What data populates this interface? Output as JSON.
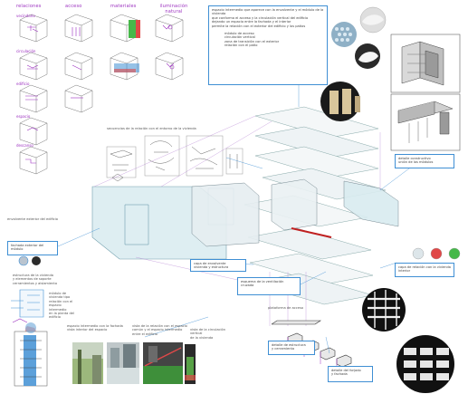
{
  "columns": [
    "relaciones",
    "acceso",
    "materiales",
    "iluminación natural"
  ],
  "rows": [
    "vecindario",
    "circulación",
    "edificio",
    "espacio",
    "descanso"
  ],
  "notes": {
    "top_text": "espacio intermedio que aparece con la envolvente y el módulo de la vivienda\nque conforma el acceso y la circulación vertical del edificio\ndejando un espacio entre la fachada y el interior\npermite la relación con el exterior del edificio y los patios",
    "top_sub": "módulo de acceso\ncirculación vertical\nzona de transición con el exterior\nrelación con el patio",
    "sketches": "secuencias de la relación con el entorno de la vivienda",
    "facade_label": "envolvente exterior del edificio",
    "left_mid": "fachada exterior del módulo",
    "env_label": "capa de envolvente\nvivienda y estructura",
    "circ_label": "esquema de la ventilación cruzada",
    "struct_label": "estructura de la vivienda\ny elementos de soporte\ncerramientos y aislamiento",
    "access_label": "plataforma de acceso",
    "right_top_label": "detalle constructivo\nunión de los módulos",
    "right_mid_label": "capa de relación con la vivienda\ninterior",
    "bottom_left": "módulo de vivienda tipo\nrelación con el espacio intermedio\nen la planta del edificio",
    "bottom_left2": "espacio intermedio con la fachada\nvista interior del espacio",
    "bottom_mid": "vista de la relación con el espacio\ncomún y el espacio intermedio\nentre el edificio",
    "bottom_mid2": "vista de la circulación vertical\nde la vivienda",
    "bottom_floor": "detalle de estructura\ny cerramiento",
    "bottom_right": "detalle del forjado\ny fachada"
  },
  "swatches": [
    "#dde6ea",
    "#e04848",
    "#46b84a",
    "#3f8fd4"
  ],
  "colors": {
    "accent": "#9b2fbf",
    "line": "#3f8fd4",
    "red": "#e04848",
    "green": "#46b84a"
  }
}
